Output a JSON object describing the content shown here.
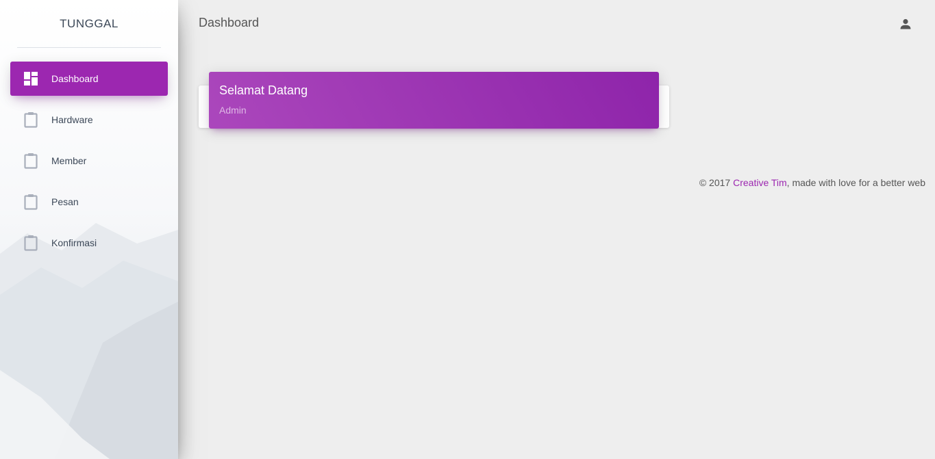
{
  "brand": {
    "name": "TUNGGAL"
  },
  "sidebar": {
    "items": [
      {
        "label": "Dashboard",
        "icon": "dashboard-icon",
        "active": true
      },
      {
        "label": "Hardware",
        "icon": "clipboard-icon",
        "active": false
      },
      {
        "label": "Member",
        "icon": "clipboard-icon",
        "active": false
      },
      {
        "label": "Pesan",
        "icon": "clipboard-icon",
        "active": false
      },
      {
        "label": "Konfirmasi",
        "icon": "clipboard-icon",
        "active": false
      }
    ]
  },
  "topbar": {
    "title": "Dashboard",
    "user_icon": "person-icon"
  },
  "welcome_card": {
    "title": "Selamat Datang",
    "subtitle": "Admin"
  },
  "footer": {
    "prefix": "© 2017 ",
    "link": "Creative Tim",
    "suffix": ", made with love for a better web"
  },
  "colors": {
    "accent": "#9c27b0",
    "background": "#eeeeee",
    "icon_gray": "#a9afbb"
  }
}
